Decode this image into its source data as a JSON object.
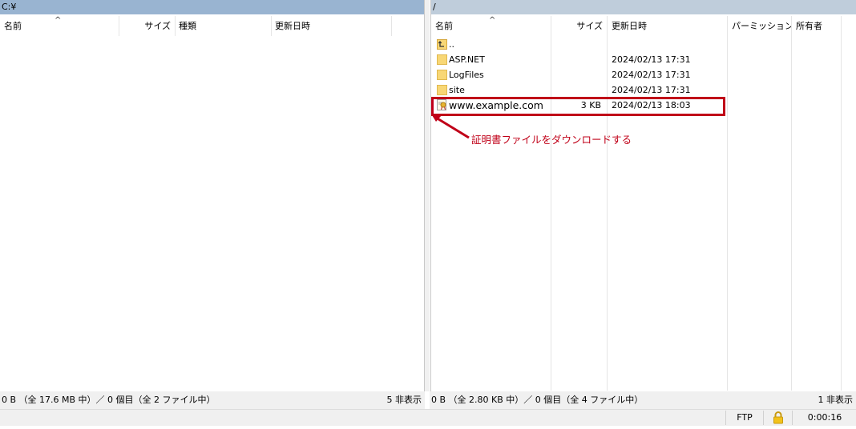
{
  "left_pane": {
    "path": "C:¥",
    "columns": [
      "名前",
      "サイズ",
      "種類",
      "更新日時"
    ],
    "status": "0 B （全 17.6 MB 中）／ 0 個目（全 2 ファイル中）",
    "hidden": "5 非表示"
  },
  "right_pane": {
    "path": "/",
    "columns": [
      "名前",
      "サイズ",
      "更新日時",
      "パーミッション",
      "所有者"
    ],
    "files": [
      {
        "name": "..",
        "size": "",
        "modified": "",
        "icon": "parent-folder-icon"
      },
      {
        "name": "ASP.NET",
        "size": "",
        "modified": "2024/02/13 17:31",
        "icon": "folder-icon"
      },
      {
        "name": "LogFiles",
        "size": "",
        "modified": "2024/02/13 17:31",
        "icon": "folder-icon"
      },
      {
        "name": "site",
        "size": "",
        "modified": "2024/02/13 17:31",
        "icon": "folder-icon"
      },
      {
        "name": "www.example.com",
        "size": "3 KB",
        "modified": "2024/02/13 18:03",
        "icon": "certificate-file-icon"
      }
    ],
    "status": "0 B （全 2.80 KB 中）／ 0 個目（全 4 ファイル中）",
    "hidden": "1 非表示"
  },
  "annotation": {
    "text": "証明書ファイルをダウンロードする",
    "color": "#c00018"
  },
  "bottom_bar": {
    "protocol": "FTP",
    "lock_icon": "lock-icon",
    "elapsed": "0:00:16"
  },
  "colors": {
    "left_path_bg": "#99b4d1",
    "right_path_bg": "#bfcddb",
    "folder": "#f8d775",
    "annotation": "#c00018"
  }
}
